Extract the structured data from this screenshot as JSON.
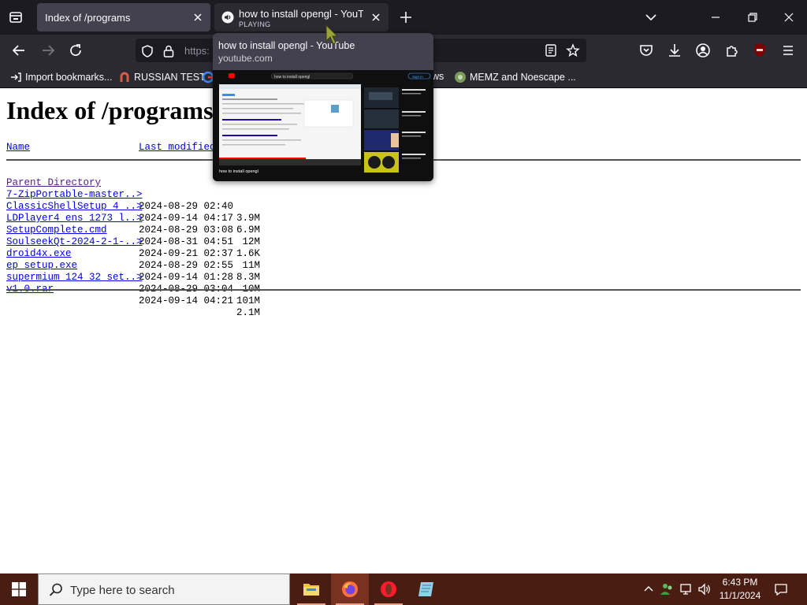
{
  "tabs": [
    {
      "title": "Index of /programs"
    },
    {
      "title": "how to install opengl - YouTube",
      "status": "PLAYING"
    }
  ],
  "address": {
    "value": "https:"
  },
  "bookmarks": [
    {
      "label": "Import bookmarks..."
    },
    {
      "label": "RUSSIAN TEST"
    },
    {
      "label": "ws"
    },
    {
      "label": "MEMZ and Noescape ..."
    }
  ],
  "tab_preview": {
    "title": "how to install opengl - YouTube",
    "url": "youtube.com",
    "thumb_search": "how to install opengl",
    "thumb_signin": "Sign in",
    "thumb_caption": "how to install opengl"
  },
  "page": {
    "title": "Index of /programs",
    "columns": {
      "name": "Name",
      "last_modified": "Last modified"
    },
    "parent": "Parent Directory",
    "files": [
      {
        "name": "7-ZipPortable-master..>",
        "date": "2024-08-29 02:40",
        "size": "3.9M"
      },
      {
        "name": "ClassicShellSetup 4 ..>",
        "date": "2024-09-14 04:17",
        "size": "6.9M"
      },
      {
        "name": "LDPlayer4 ens 1273 l..>",
        "date": "2024-08-29 03:08",
        "size": "12M"
      },
      {
        "name": "SetupComplete.cmd",
        "date": "2024-08-31 04:51",
        "size": "1.6K"
      },
      {
        "name": "SoulseekQt-2024-2-1-..>",
        "date": "2024-09-21 02:37",
        "size": "11M"
      },
      {
        "name": "droid4x.exe",
        "date": "2024-08-29 02:55",
        "size": "8.3M"
      },
      {
        "name": "ep setup.exe",
        "date": "2024-09-14 01:28",
        "size": "10M"
      },
      {
        "name": "supermium 124 32 set..>",
        "date": "2024-08-29 03:04",
        "size": "101M"
      },
      {
        "name": "v1.0.rar",
        "date": "2024-09-14 04:21",
        "size": "2.1M"
      }
    ]
  },
  "taskbar": {
    "search_placeholder": "Type here to search",
    "time": "6:43 PM",
    "date": "11/1/2024"
  },
  "colors": {
    "link": "#0000ee",
    "visited": "#551a8b",
    "taskbar": "#4a1d12",
    "chrome": "#2b2a33"
  }
}
